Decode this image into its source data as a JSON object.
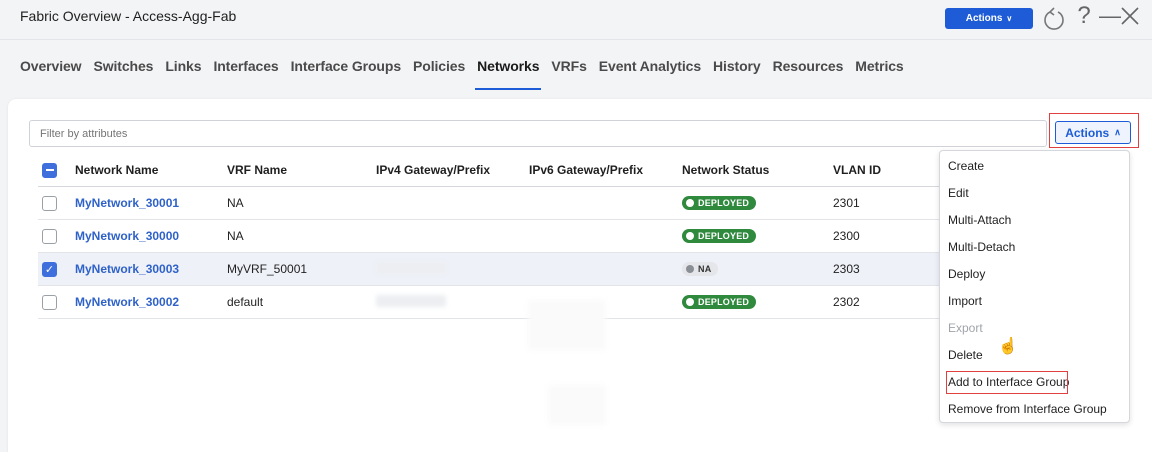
{
  "window": {
    "title": "Fabric Overview - Access-Agg-Fab",
    "actions_label": "Actions",
    "actions_chevron": "∨",
    "help_glyph": "?",
    "minimize_glyph": "—"
  },
  "tabs": [
    {
      "label": "Overview"
    },
    {
      "label": "Switches"
    },
    {
      "label": "Links"
    },
    {
      "label": "Interfaces"
    },
    {
      "label": "Interface Groups"
    },
    {
      "label": "Policies"
    },
    {
      "label": "Networks",
      "active": true
    },
    {
      "label": "VRFs"
    },
    {
      "label": "Event Analytics"
    },
    {
      "label": "History"
    },
    {
      "label": "Resources"
    },
    {
      "label": "Metrics"
    }
  ],
  "filter": {
    "placeholder": "Filter by attributes"
  },
  "actions_button": {
    "label": "Actions",
    "chevron": "∧"
  },
  "table": {
    "columns": [
      "Network Name",
      "VRF Name",
      "IPv4 Gateway/Prefix",
      "IPv6 Gateway/Prefix",
      "Network Status",
      "VLAN ID"
    ],
    "rows": [
      {
        "name": "MyNetwork_30001",
        "vrf": "NA",
        "status": "DEPLOYED",
        "vlan": "2301",
        "selected": false,
        "ipv4_blurred": false
      },
      {
        "name": "MyNetwork_30000",
        "vrf": "NA",
        "status": "DEPLOYED",
        "vlan": "2300",
        "selected": false,
        "ipv4_blurred": false
      },
      {
        "name": "MyNetwork_30003",
        "vrf": "MyVRF_50001",
        "status": "NA",
        "vlan": "2303",
        "selected": true,
        "ipv4_blurred": true
      },
      {
        "name": "MyNetwork_30002",
        "vrf": "default",
        "status": "DEPLOYED",
        "vlan": "2302",
        "selected": false,
        "ipv4_blurred": true
      }
    ]
  },
  "menu": {
    "items": [
      {
        "label": "Create"
      },
      {
        "label": "Edit"
      },
      {
        "label": "Multi-Attach"
      },
      {
        "label": "Multi-Detach"
      },
      {
        "label": "Deploy"
      },
      {
        "label": "Import"
      },
      {
        "label": "Export",
        "disabled": true
      },
      {
        "label": "Delete"
      },
      {
        "label": "Add to Interface Group",
        "highlighted": true
      },
      {
        "label": "Remove from Interface Group"
      }
    ]
  },
  "colors": {
    "accent": "#1d5cd6",
    "deployed": "#2f8a3e",
    "highlight_box": "#e04040"
  }
}
